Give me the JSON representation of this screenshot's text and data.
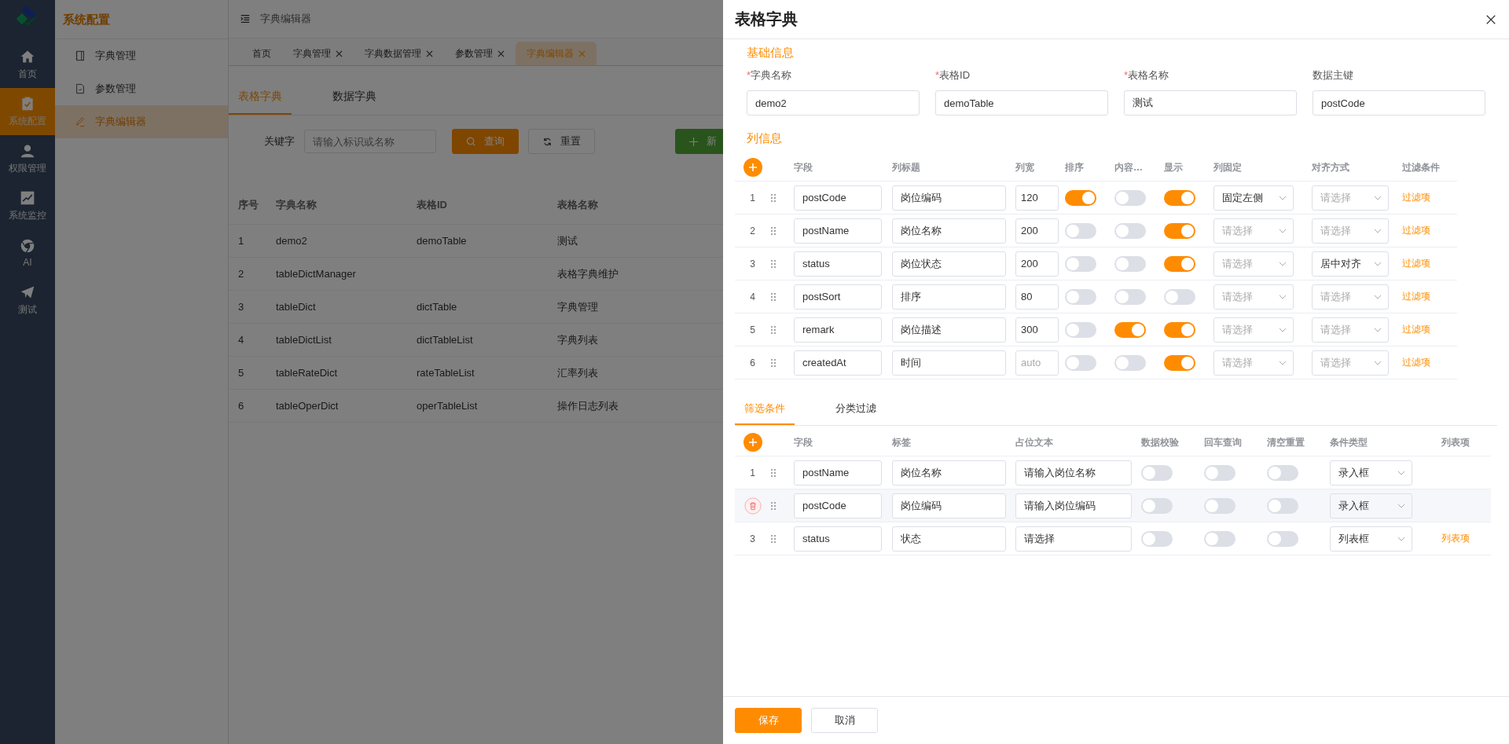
{
  "rail": [
    {
      "label": "首页",
      "selected": false
    },
    {
      "label": "系统配置",
      "selected": true
    },
    {
      "label": "权限管理",
      "selected": false
    },
    {
      "label": "系统监控",
      "selected": false
    },
    {
      "label": "AI",
      "selected": false
    },
    {
      "label": "测试",
      "selected": false
    }
  ],
  "submenu": {
    "title": "系统配置",
    "items": [
      {
        "label": "字典管理",
        "selected": false
      },
      {
        "label": "参数管理",
        "selected": false
      },
      {
        "label": "字典编辑器",
        "selected": true
      }
    ]
  },
  "header": {
    "breadcrumb": "字典编辑器"
  },
  "page_tabs": [
    {
      "label": "首页",
      "closable": false,
      "selected": false
    },
    {
      "label": "字典管理",
      "closable": true,
      "selected": false
    },
    {
      "label": "字典数据管理",
      "closable": true,
      "selected": false
    },
    {
      "label": "参数管理",
      "closable": true,
      "selected": false
    },
    {
      "label": "字典编辑器",
      "closable": true,
      "selected": true
    }
  ],
  "content_tabs": [
    {
      "label": "表格字典",
      "selected": true
    },
    {
      "label": "数据字典",
      "selected": false
    }
  ],
  "search": {
    "label": "关键字",
    "placeholder": "请输入标识或名称",
    "query_button": "查询",
    "reset_button": "重置",
    "add_button": "新"
  },
  "table": {
    "columns": [
      "序号",
      "字典名称",
      "表格ID",
      "表格名称"
    ],
    "rows": [
      {
        "index": "1",
        "name": "demo2",
        "table_id": "demoTable",
        "table_name": "测试"
      },
      {
        "index": "2",
        "name": "tableDictManager",
        "table_name": "表格字典维护"
      },
      {
        "index": "3",
        "name": "tableDict",
        "table_id": "dictTable",
        "table_name": "字典管理"
      },
      {
        "index": "4",
        "name": "tableDictList",
        "table_id": "dictTableList",
        "table_name": "字典列表"
      },
      {
        "index": "5",
        "name": "tableRateDict",
        "table_id": "rateTableList",
        "table_name": "汇率列表"
      },
      {
        "index": "6",
        "name": "tableOperDict",
        "table_id": "operTableList",
        "table_name": "操作日志列表"
      }
    ]
  },
  "drawer": {
    "title": "表格字典",
    "basic": {
      "title": "基础信息",
      "fields": [
        {
          "required_mark": "*",
          "label": "字典名称",
          "value": "demo2"
        },
        {
          "required_mark": "*",
          "label": "表格ID",
          "value": "demoTable"
        },
        {
          "required_mark": "*",
          "label": "表格名称",
          "value": "测试"
        },
        {
          "label": "数据主键",
          "value": "postCode"
        }
      ]
    },
    "columns": {
      "title": "列信息",
      "headers": [
        "字段",
        "列标题",
        "列宽",
        "排序",
        "内容…",
        "显示",
        "列固定",
        "对齐方式",
        "过滤条件"
      ],
      "rows": [
        {
          "index": "1",
          "field": "postCode",
          "title": "岗位编码",
          "width": {
            "value": "120"
          },
          "sort": true,
          "ellipsis": false,
          "show": true,
          "fixed": {
            "value": "固定左侧"
          },
          "align": {
            "placeholder": "请选择"
          },
          "filter": "过滤项"
        },
        {
          "index": "2",
          "field": "postName",
          "title": "岗位名称",
          "width": {
            "value": "200"
          },
          "sort": false,
          "ellipsis": false,
          "show": true,
          "fixed": {
            "placeholder": "请选择"
          },
          "align": {
            "placeholder": "请选择"
          },
          "filter": "过滤项"
        },
        {
          "index": "3",
          "field": "status",
          "title": "岗位状态",
          "width": {
            "value": "200"
          },
          "sort": false,
          "ellipsis": false,
          "show": true,
          "fixed": {
            "placeholder": "请选择"
          },
          "align": {
            "value": "居中对齐"
          },
          "filter": "过滤项"
        },
        {
          "index": "4",
          "field": "postSort",
          "title": "排序",
          "width": {
            "value": "80"
          },
          "sort": false,
          "ellipsis": false,
          "show": false,
          "fixed": {
            "placeholder": "请选择"
          },
          "align": {
            "placeholder": "请选择"
          },
          "filter": "过滤项"
        },
        {
          "index": "5",
          "field": "remark",
          "title": "岗位描述",
          "width": {
            "value": "300"
          },
          "sort": false,
          "ellipsis": true,
          "show": true,
          "fixed": {
            "placeholder": "请选择"
          },
          "align": {
            "placeholder": "请选择"
          },
          "filter": "过滤项"
        },
        {
          "index": "6",
          "field": "createdAt",
          "title": "时间",
          "width": {
            "placeholder": "auto"
          },
          "sort": false,
          "ellipsis": false,
          "show": true,
          "fixed": {
            "placeholder": "请选择"
          },
          "align": {
            "placeholder": "请选择"
          },
          "filter": "过滤项"
        }
      ]
    },
    "filter_tabs": [
      {
        "label": "筛选条件",
        "selected": true
      },
      {
        "label": "分类过滤",
        "selected": false
      }
    ],
    "filters": {
      "headers": [
        "字段",
        "标签",
        "占位文本",
        "数据校验",
        "回车查询",
        "清空重置",
        "条件类型",
        "列表项"
      ],
      "rows": [
        {
          "index": "1",
          "hovered": false,
          "field": "postName",
          "label": "岗位名称",
          "text_value": "请输入岗位名称",
          "validate": false,
          "enter_query": false,
          "clear_reset": false,
          "type": "录入框"
        },
        {
          "hovered": true,
          "field": "postCode",
          "label": "岗位编码",
          "text_value": "请输入岗位编码",
          "validate": false,
          "enter_query": false,
          "clear_reset": false,
          "type": "录入框"
        },
        {
          "index": "3",
          "hovered": false,
          "field": "status",
          "label": "状态",
          "text_value": "请选择",
          "validate": false,
          "enter_query": false,
          "clear_reset": false,
          "type": "列表框",
          "list_item": "列表项"
        }
      ]
    },
    "footer": {
      "save": "保存",
      "cancel": "取消"
    }
  }
}
